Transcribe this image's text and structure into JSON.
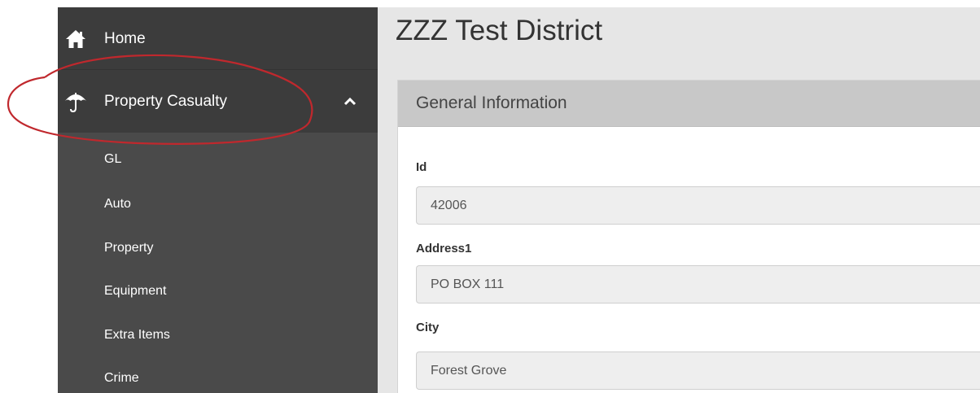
{
  "sidebar": {
    "home_label": "Home",
    "section_label": "Property Casualty",
    "sub_items": [
      "GL",
      "Auto",
      "Property",
      "Equipment",
      "Extra Items",
      "Crime"
    ]
  },
  "main": {
    "page_title": "ZZZ Test District",
    "panel_title": "General Information",
    "fields": [
      {
        "label": "Id",
        "value": "42006"
      },
      {
        "label": "Address1",
        "value": "PO BOX 111"
      },
      {
        "label": "City",
        "value": "Forest Grove"
      }
    ]
  },
  "colors": {
    "sidebar_bg": "#4a4a4a",
    "sidebar_top_bg": "#3c3c3c",
    "main_bg": "#e6e6e6",
    "panel_heading_bg": "#c8c8c8",
    "annotation_red": "#c0282d"
  },
  "icons": {
    "home": "home-icon",
    "section": "umbrella-icon",
    "toggle": "chevron-up-icon"
  }
}
